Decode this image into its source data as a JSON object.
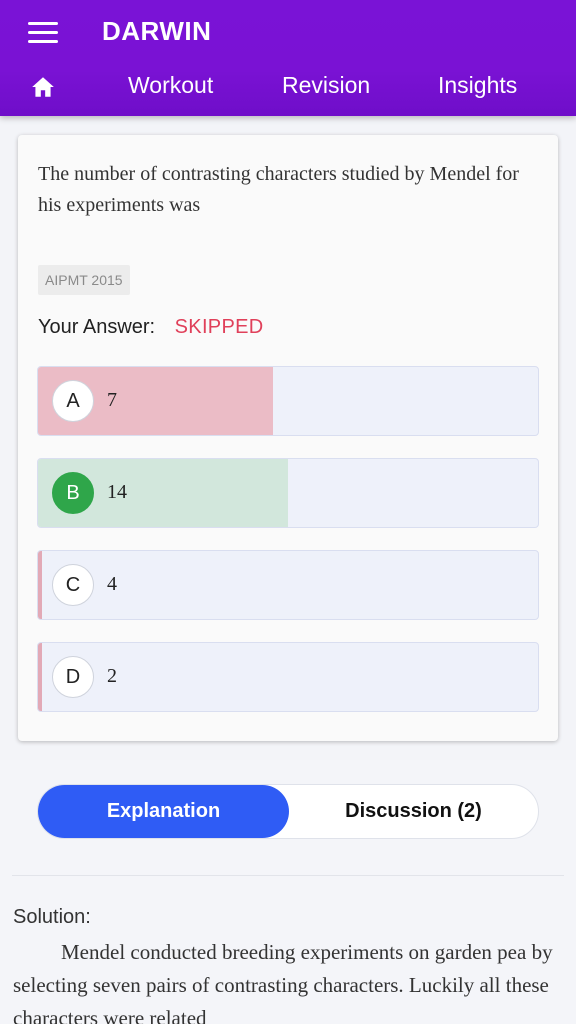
{
  "app": {
    "title": "DARWIN"
  },
  "nav": {
    "tabs": [
      "Workout",
      "Revision",
      "Insights"
    ]
  },
  "question": {
    "text": "The number of contrasting characters studied by Mendel for his experiments was",
    "tag": "AIPMT 2015",
    "answer_label": "Your Answer:",
    "answer_value": "SKIPPED"
  },
  "options": [
    {
      "letter": "A",
      "text": "7",
      "status": "incorrect-response",
      "share": 0.47
    },
    {
      "letter": "B",
      "text": "14",
      "status": "correct",
      "share": 0.5
    },
    {
      "letter": "C",
      "text": "4",
      "status": "none",
      "share": 0
    },
    {
      "letter": "D",
      "text": "2",
      "status": "none",
      "share": 0
    }
  ],
  "colors": {
    "header": "#7a13d6",
    "skipped": "#e0405a",
    "wrong_fill": "#ebbcc6",
    "correct_fill": "#d2e7dc",
    "correct_badge": "#2fa64a",
    "active_tab": "#2f5cf5"
  },
  "tabs": {
    "explanation": "Explanation",
    "discussion": "Discussion (2)"
  },
  "solution": {
    "label": "Solution:",
    "text": "Mendel conducted breeding experiments on garden pea by selecting seven pairs of contrasting characters. Luckily all these characters were related"
  }
}
